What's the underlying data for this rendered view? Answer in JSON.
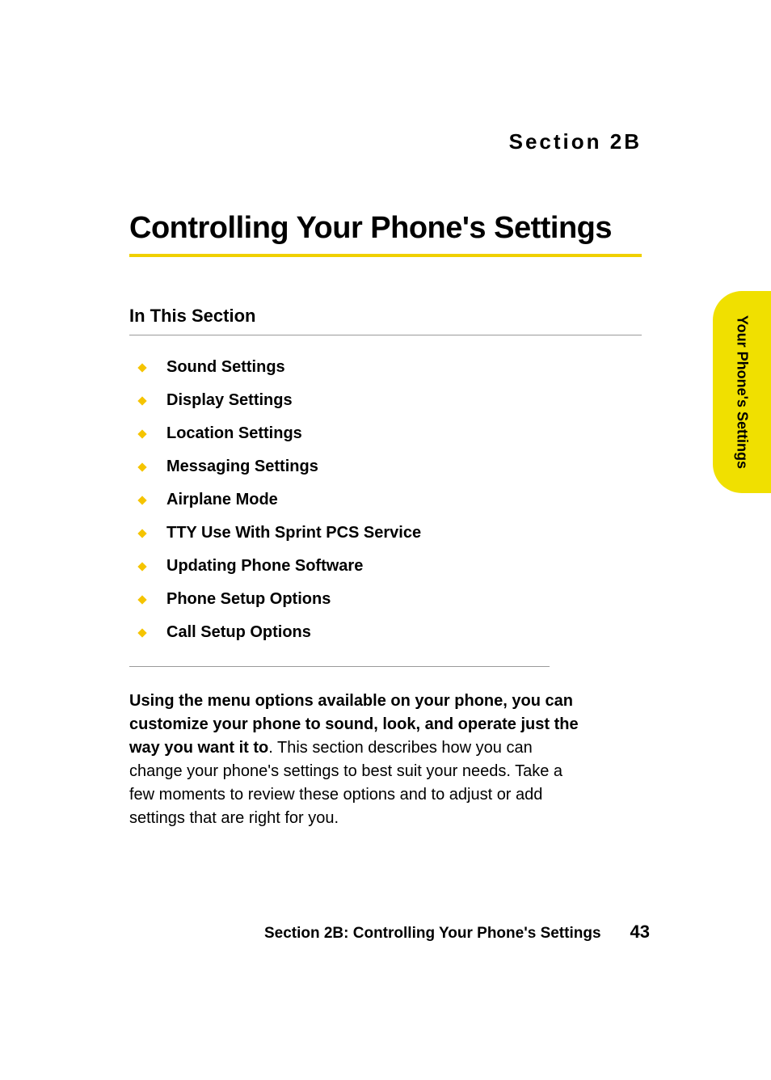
{
  "section_label": "Section 2B",
  "page_title": "Controlling Your Phone's Settings",
  "subsection_title": "In This Section",
  "toc": [
    "Sound Settings",
    "Display Settings",
    "Location Settings",
    "Messaging Settings",
    "Airplane Mode",
    "TTY Use With Sprint PCS Service",
    "Updating Phone Software",
    "Phone Setup Options",
    "Call Setup Options"
  ],
  "paragraph_bold": "Using the menu options available on your phone, you can customize your phone to sound, look, and operate just the way you want it to",
  "paragraph_rest": ". This section describes how you can change your phone's settings to best suit your needs. Take a few moments to review these options and to adjust or add settings that are right for you.",
  "side_tab": "Your Phone's Settings",
  "footer_title": "Section 2B: Controlling Your Phone's Settings",
  "footer_page": "43"
}
